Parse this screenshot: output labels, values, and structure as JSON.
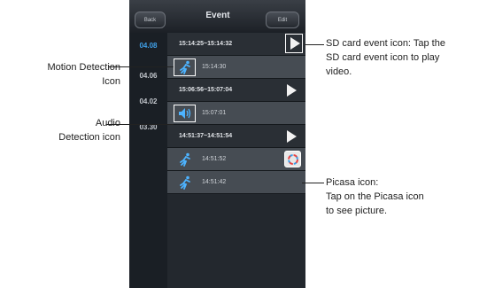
{
  "header": {
    "back_label": "Back",
    "title": "Event",
    "edit_label": "Edit"
  },
  "sidebar": {
    "items": [
      {
        "label": "04.08",
        "active": true
      },
      {
        "label": "04.06",
        "active": false
      },
      {
        "label": "04.02",
        "active": false
      },
      {
        "label": "03.30",
        "active": false
      }
    ]
  },
  "events": [
    {
      "type": "section",
      "label": "15:14:25~15:14:32",
      "icon": "play-icon"
    },
    {
      "type": "item",
      "label": "15:14:30",
      "icon": "motion-detection-icon"
    },
    {
      "type": "section",
      "label": "15:06:56~15:07:04",
      "icon": "play-icon"
    },
    {
      "type": "item",
      "label": "15:07:01",
      "icon": "audio-detection-icon"
    },
    {
      "type": "section",
      "label": "14:51:37~14:51:54",
      "icon": "play-icon"
    },
    {
      "type": "item",
      "label": "14:51:52",
      "icon": "motion-detection-icon",
      "extra_icon": "picasa-icon"
    },
    {
      "type": "item",
      "label": "14:51:42",
      "icon": "motion-detection-icon"
    }
  ],
  "annotations": {
    "motion": "Motion Detection\nIcon",
    "audio": "Audio\nDetection icon",
    "sdcard": "SD card event icon: Tap the\nSD card event icon to play\nvideo.",
    "picasa": "Picasa icon:\nTap on the Picasa icon\nto see picture."
  },
  "colors": {
    "accent": "#3fa0e8",
    "header_bg": "#2a2e34",
    "row_bg": "#464c53",
    "sidebar_bg": "#1a1f25"
  }
}
